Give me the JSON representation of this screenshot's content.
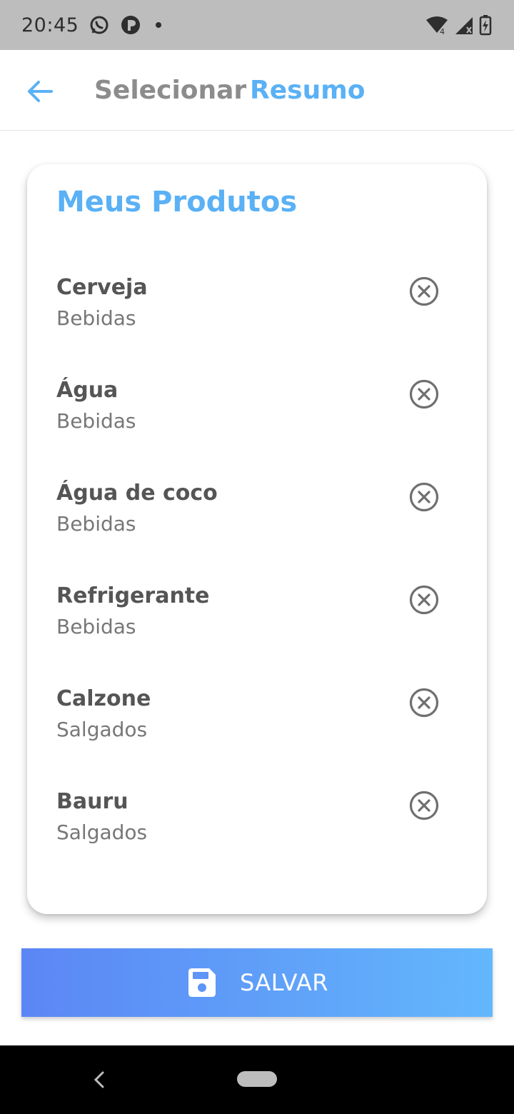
{
  "status": {
    "time": "20:45",
    "icons": [
      "whatsapp-icon",
      "app-notification-icon",
      "dot-icon",
      "wifi-icon",
      "signal-icon",
      "battery-icon"
    ]
  },
  "header": {
    "back_icon": "arrow-left-icon",
    "tabs": [
      {
        "label": "Selecionar",
        "active": false
      },
      {
        "label": "Resumo",
        "active": true
      }
    ]
  },
  "card": {
    "title": "Meus Produtos",
    "items": [
      {
        "name": "Cerveja",
        "category": "Bebidas"
      },
      {
        "name": "Água",
        "category": "Bebidas"
      },
      {
        "name": "Água de coco",
        "category": "Bebidas"
      },
      {
        "name": "Refrigerante",
        "category": "Bebidas"
      },
      {
        "name": "Calzone",
        "category": "Salgados"
      },
      {
        "name": "Bauru",
        "category": "Salgados"
      }
    ],
    "remove_icon": "remove-circle-icon"
  },
  "save_button": {
    "label": "SALVAR",
    "icon": "save-icon"
  },
  "colors": {
    "accent": "#5ab1f5",
    "inactive_tab": "#8c8c8c",
    "button_gradient_start": "#5b86f5",
    "button_gradient_end": "#63b7fc",
    "status_bar": "#bdbdbd"
  }
}
